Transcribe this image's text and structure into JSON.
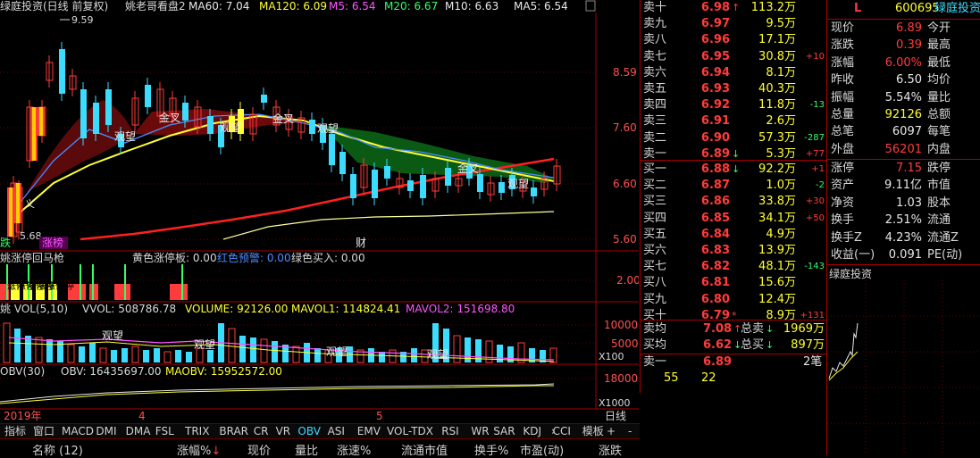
{
  "chart_header": {
    "title": "绿庭投资(日线 前复权)",
    "indicator_name": "姚老哥看盘2",
    "ma60": "MA60: 7.04",
    "ma120": "MA120: 6.09",
    "m5": "M5: 6.54",
    "m20": "M20: 6.67",
    "m10": "M10: 6.63",
    "ma5": "MA5: 6.54"
  },
  "price_axis": [
    "8.59",
    "7.60",
    "6.60",
    "5.60"
  ],
  "price_marks": {
    "high": "9.59",
    "low": "5.68"
  },
  "chart_labels": {
    "guanwang": "观望",
    "jincha": "金叉",
    "zhangting": "涨榜",
    "cai": "财",
    "die": "跌",
    "yi": "义"
  },
  "limit_panel": {
    "name": "姚涨停回马枪",
    "label1": "黄色涨停板: 0.00",
    "label2": "红色预警: 0.00",
    "label3": "绿色买入: 0.00",
    "axis": "2.00",
    "zhangting_word": "涨停"
  },
  "vol_panel": {
    "name": "姚 VOL(5,10)",
    "vvol": "VVOL: 508786.78",
    "volume": "VOLUME: 92126.00",
    "mavol1": "MAVOL1: 114824.41",
    "mavol2": "MAVOL2: 151698.80",
    "axis": [
      "10000",
      "5000"
    ],
    "unit": "X100"
  },
  "obv_panel": {
    "name": "OBV(30)",
    "obv": "OBV: 16435697.00",
    "maobv": "MAOBV: 15952572.00",
    "axis": "18000",
    "unit": "X1000"
  },
  "time_axis": {
    "year": "2019年",
    "m1": "4",
    "m2": "5",
    "period": "日线"
  },
  "tabs": [
    "指标",
    "窗口",
    "MACD",
    "DMI",
    "DMA",
    "FSL",
    "TRIX",
    "BRAR",
    "CR",
    "VR",
    "OBV",
    "ASI",
    "EMV",
    "VOL-TDX",
    "RSI",
    "WR",
    "SAR",
    "KDJ",
    "CCI",
    "模板"
  ],
  "active_tab": "OBV",
  "list_header": [
    "名称 (12)",
    "涨幅%",
    "现价",
    "量比",
    "涨速%",
    "流通市值",
    "换手%",
    "市盈(动)",
    "涨跌"
  ],
  "sells": [
    {
      "label": "卖十",
      "price": "6.98",
      "arrow": "↑",
      "vol": "113.2万",
      "chg": ""
    },
    {
      "label": "卖九",
      "price": "6.97",
      "arrow": "",
      "vol": "9.5万",
      "chg": ""
    },
    {
      "label": "卖八",
      "price": "6.96",
      "arrow": "",
      "vol": "17.1万",
      "chg": ""
    },
    {
      "label": "卖七",
      "price": "6.95",
      "arrow": "",
      "vol": "30.8万",
      "chg": "+10"
    },
    {
      "label": "卖六",
      "price": "6.94",
      "arrow": "",
      "vol": "8.1万",
      "chg": ""
    },
    {
      "label": "卖五",
      "price": "6.93",
      "arrow": "",
      "vol": "40.3万",
      "chg": ""
    },
    {
      "label": "卖四",
      "price": "6.92",
      "arrow": "",
      "vol": "11.8万",
      "chg": "-13"
    },
    {
      "label": "卖三",
      "price": "6.91",
      "arrow": "",
      "vol": "2.6万",
      "chg": ""
    },
    {
      "label": "卖二",
      "price": "6.90",
      "arrow": "",
      "vol": "57.3万",
      "chg": "-287"
    },
    {
      "label": "卖一",
      "price": "6.89",
      "arrow": "↓",
      "vol": "5.3万",
      "chg": "+77"
    }
  ],
  "buys": [
    {
      "label": "买一",
      "price": "6.88",
      "arrow": "↓",
      "vol": "92.2万",
      "chg": "+1"
    },
    {
      "label": "买二",
      "price": "6.87",
      "arrow": "",
      "vol": "1.0万",
      "chg": "-2"
    },
    {
      "label": "买三",
      "price": "6.86",
      "arrow": "",
      "vol": "33.8万",
      "chg": "+30"
    },
    {
      "label": "买四",
      "price": "6.85",
      "arrow": "",
      "vol": "34.1万",
      "chg": "+50"
    },
    {
      "label": "买五",
      "price": "6.84",
      "arrow": "",
      "vol": "4.9万",
      "chg": ""
    },
    {
      "label": "买六",
      "price": "6.83",
      "arrow": "",
      "vol": "13.9万",
      "chg": ""
    },
    {
      "label": "买七",
      "price": "6.82",
      "arrow": "",
      "vol": "48.1万",
      "chg": "-143"
    },
    {
      "label": "买八",
      "price": "6.81",
      "arrow": "",
      "vol": "15.6万",
      "chg": ""
    },
    {
      "label": "买九",
      "price": "6.80",
      "arrow": "",
      "vol": "12.4万",
      "chg": ""
    },
    {
      "label": "买十",
      "price": "6.79",
      "arrow": "*",
      "vol": "8.9万",
      "chg": "+131"
    }
  ],
  "avg": [
    {
      "label": "卖均",
      "price": "7.08",
      "arrow": "↑",
      "label2": "总卖",
      "arrow2": "↓",
      "vol": "1969万"
    },
    {
      "label": "买均",
      "price": "6.62",
      "arrow": "↓",
      "label2": "总买",
      "arrow2": "↓",
      "vol": "897万"
    }
  ],
  "last_trade": {
    "label": "卖一",
    "price": "6.89",
    "count": "2笔",
    "v1": "55",
    "v2": "22"
  },
  "quote_header": {
    "marker": "L",
    "code": "600695",
    "name": "绿庭投资"
  },
  "quote_rows": [
    {
      "l1": "现价",
      "v1": "6.89",
      "c1": "red",
      "l2": "今开"
    },
    {
      "l1": "涨跌",
      "v1": "0.39",
      "c1": "red",
      "l2": "最高"
    },
    {
      "l1": "涨幅",
      "v1": "6.00%",
      "c1": "red",
      "l2": "最低"
    },
    {
      "l1": "昨收",
      "v1": "6.50",
      "c1": "white",
      "l2": "均价"
    },
    {
      "l1": "振幅",
      "v1": "5.54%",
      "c1": "white",
      "l2": "量比"
    },
    {
      "l1": "总量",
      "v1": "92126",
      "c1": "yellow",
      "l2": "总额"
    },
    {
      "l1": "总笔",
      "v1": "6097",
      "c1": "white",
      "l2": "每笔"
    },
    {
      "l1": "外盘",
      "v1": "56201",
      "c1": "red",
      "l2": "内盘"
    }
  ],
  "quote_rows2": [
    {
      "l1": "涨停",
      "v1": "7.15",
      "c1": "red",
      "l2": "跌停"
    },
    {
      "l1": "资产",
      "v1": "9.11亿",
      "c1": "white",
      "l2": "市值"
    },
    {
      "l1": "净资",
      "v1": "1.03",
      "c1": "white",
      "l2": "股本"
    },
    {
      "l1": "换手",
      "v1": "2.51%",
      "c1": "white",
      "l2": "流通"
    },
    {
      "l1": "换手Z",
      "v1": "4.23%",
      "c1": "white",
      "l2": "流通Z"
    },
    {
      "l1": "收益(一)",
      "v1": "0.091",
      "c1": "white",
      "l2": "PE(动)"
    }
  ],
  "mini_title": "绿庭投资",
  "colors": {
    "up": "#ff3c3c",
    "down": "#33ff66",
    "frame": "#aa0000",
    "accent": "#3cdcff"
  }
}
